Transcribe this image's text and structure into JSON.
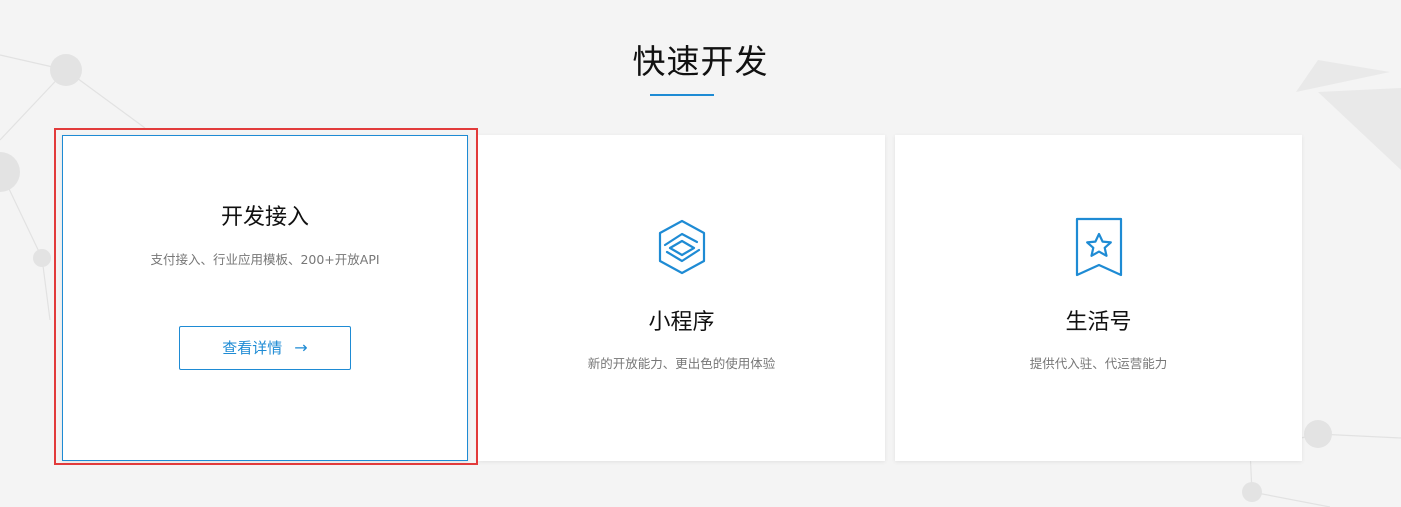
{
  "section": {
    "title": "快速开发"
  },
  "cards": [
    {
      "title": "开发接入",
      "desc": "支付接入、行业应用模板、200+开放API",
      "button_label": "查看详情",
      "button_arrow": "→"
    },
    {
      "title": "小程序",
      "desc": "新的开放能力、更出色的使用体验",
      "icon": "mini-program-icon"
    },
    {
      "title": "生活号",
      "desc": "提供代入驻、代运营能力",
      "icon": "bookmark-star-icon"
    }
  ],
  "colors": {
    "accent": "#1e8bd4",
    "highlight": "#e23b3b",
    "background": "#f4f4f4",
    "card_background": "#ffffff"
  }
}
